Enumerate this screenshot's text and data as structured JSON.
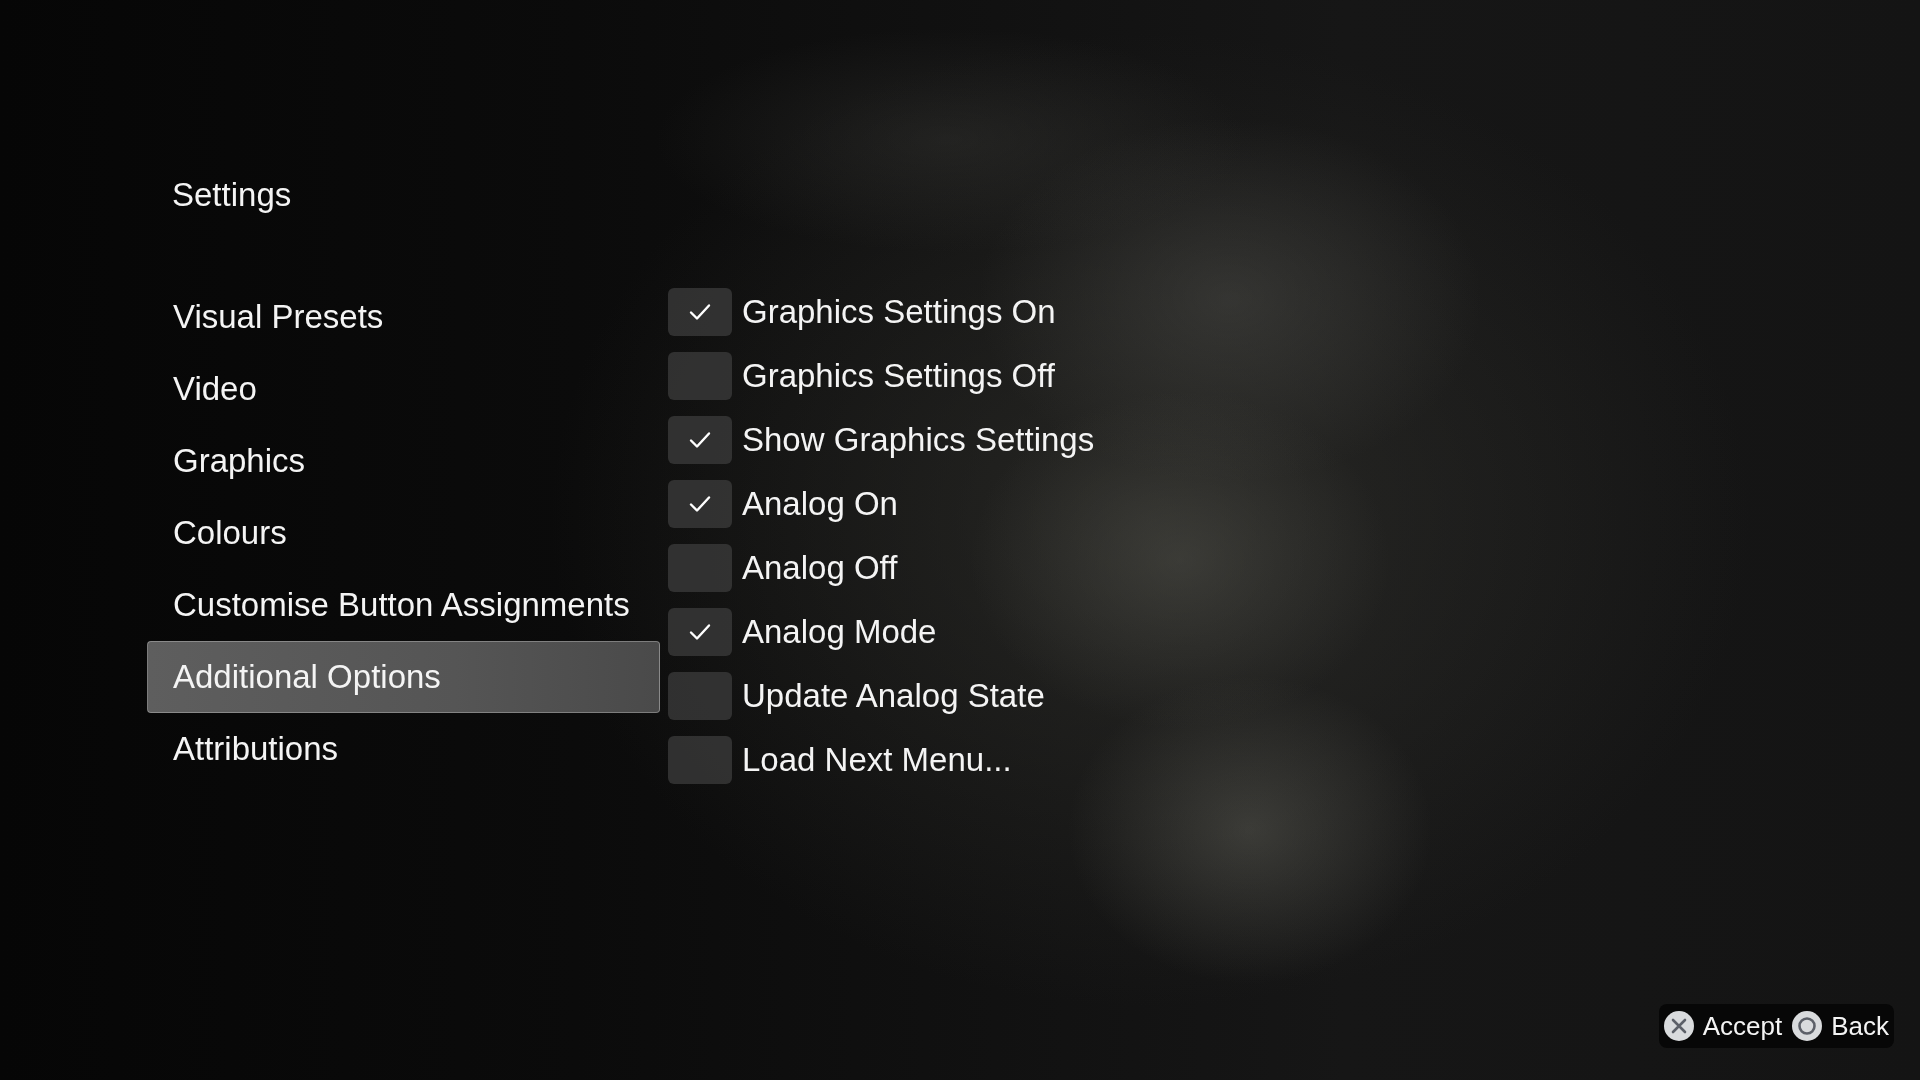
{
  "title": "Settings",
  "menu": [
    {
      "label": "Visual Presets",
      "selected": false
    },
    {
      "label": "Video",
      "selected": false
    },
    {
      "label": "Graphics",
      "selected": false
    },
    {
      "label": "Colours",
      "selected": false
    },
    {
      "label": "Customise Button Assignments",
      "selected": false
    },
    {
      "label": "Additional Options",
      "selected": true
    },
    {
      "label": "Attributions",
      "selected": false
    }
  ],
  "options": [
    {
      "label": "Graphics Settings On",
      "checked": true
    },
    {
      "label": "Graphics Settings Off",
      "checked": false
    },
    {
      "label": "Show Graphics Settings",
      "checked": true
    },
    {
      "label": "Analog On",
      "checked": true
    },
    {
      "label": "Analog Off",
      "checked": false
    },
    {
      "label": "Analog Mode",
      "checked": true
    },
    {
      "label": "Update Analog State",
      "checked": false
    },
    {
      "label": "Load Next Menu...",
      "checked": false
    }
  ],
  "footer_buttons": [
    {
      "kind": "cross",
      "label": "Accept"
    },
    {
      "kind": "circle",
      "label": "Back"
    }
  ]
}
